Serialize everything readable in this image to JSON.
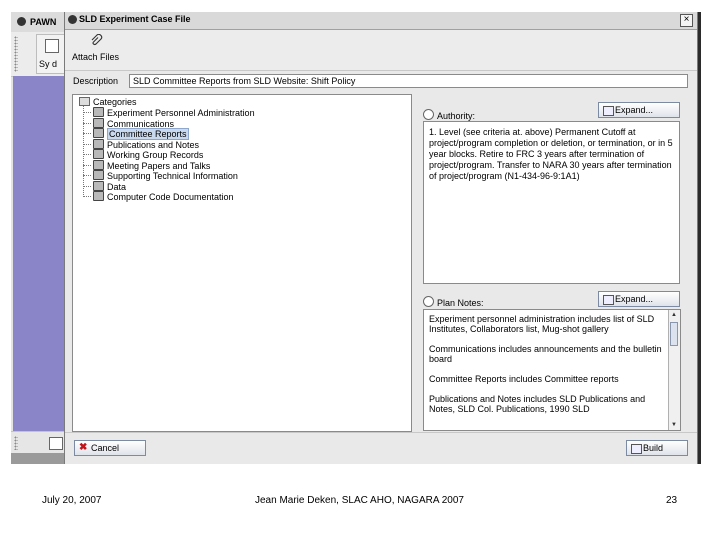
{
  "background_app": {
    "title": "PAWN",
    "tool_label": "Sy d"
  },
  "dialog": {
    "title": "SLD Experiment Case File",
    "close_label": "×",
    "toolbar": {
      "attach_label": "Attach Files"
    },
    "description_label": "Description",
    "description_value": "SLD Committee Reports from SLD Website: Shift Policy",
    "tree": {
      "root": "Categories",
      "items": [
        "Experiment Personnel Administration",
        "Communications",
        "Committee Reports",
        "Publications and Notes",
        "Working Group Records",
        "Meeting Papers and Talks",
        "Supporting Technical Information",
        "Data",
        "Computer Code Documentation"
      ],
      "selected_index": 2
    },
    "authority": {
      "label": "Authority:",
      "expand_label": "Expand...",
      "text": "1. Level (see criteria at. above) Permanent Cutoff at project/program completion or deletion, or termination, or in 5 year blocks. Retire to FRC 3 years after termination of project/program. Transfer to NARA 30 years after termination of project/program (N1-434-96-9:1A1)"
    },
    "plan_notes": {
      "label": "Plan Notes:",
      "expand_label": "Expand...",
      "paragraphs": [
        "Experiment personnel administration includes list of SLD Institutes, Collaborators list, Mug-shot gallery",
        "Communications includes announcements and the bulletin board",
        "Committee Reports includes Committee reports",
        "Publications and Notes includes SLD Publications and Notes, SLD Col. Publications, 1990 SLD"
      ]
    },
    "cancel_label": "Cancel",
    "build_label": "Build"
  },
  "footer": {
    "date": "July 20, 2007",
    "author": "Jean Marie Deken, SLAC AHO, NAGARA 2007",
    "page": "23"
  }
}
